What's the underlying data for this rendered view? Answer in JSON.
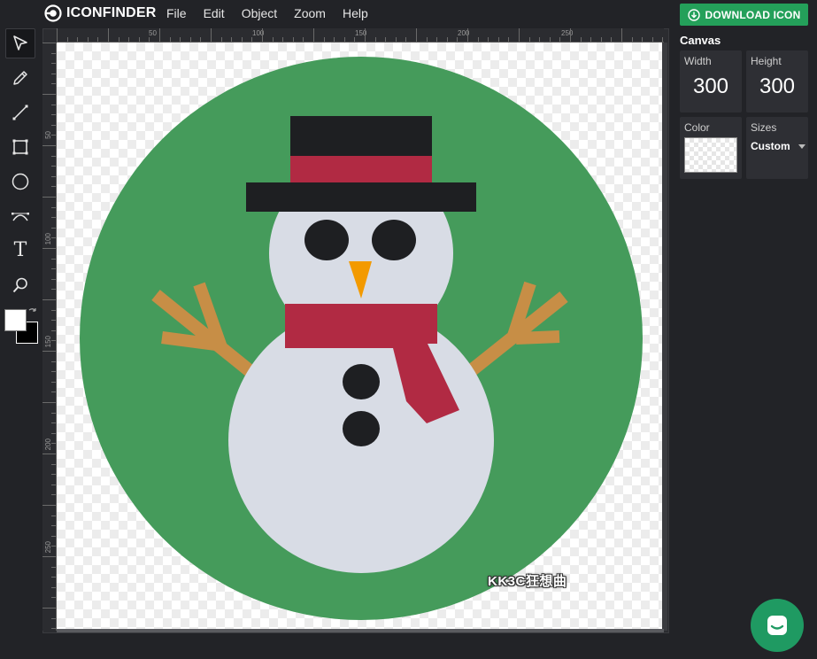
{
  "app": {
    "brand": "ICONFINDER"
  },
  "menu": {
    "items": [
      "File",
      "Edit",
      "Object",
      "Zoom",
      "Help"
    ]
  },
  "header": {
    "download_label": "DOWNLOAD ICON"
  },
  "toolbar": {
    "tools": [
      "select-icon",
      "pencil-icon",
      "line-icon",
      "rectangle-icon",
      "circle-icon",
      "bezier-icon",
      "text-icon",
      "zoom-icon"
    ],
    "text_tool_glyph": "T",
    "foreground_color": "#ffffff",
    "background_color": "#000000"
  },
  "rulers": {
    "top": [
      "50",
      "100",
      "150",
      "200",
      "250"
    ],
    "left": [
      "50",
      "100",
      "150",
      "200",
      "250"
    ]
  },
  "canvas_panel": {
    "title": "Canvas",
    "width_label": "Width",
    "width_value": "300",
    "height_label": "Height",
    "height_value": "300",
    "color_label": "Color",
    "sizes_label": "Sizes",
    "sizes_value": "Custom"
  },
  "artwork": {
    "watermark": "KK3C狂想曲",
    "colors": {
      "circle": "#459b5b",
      "snow": "#d8dce5",
      "hat": "#1e1f22",
      "hat_band": "#b12a43",
      "scarf": "#b12a43",
      "carrot": "#f39a00",
      "twig": "#c78e46",
      "coal": "#1e1f22"
    }
  },
  "colors": {
    "accent": "#24a05a",
    "chat": "#1f9a62",
    "bg": "#222327"
  }
}
